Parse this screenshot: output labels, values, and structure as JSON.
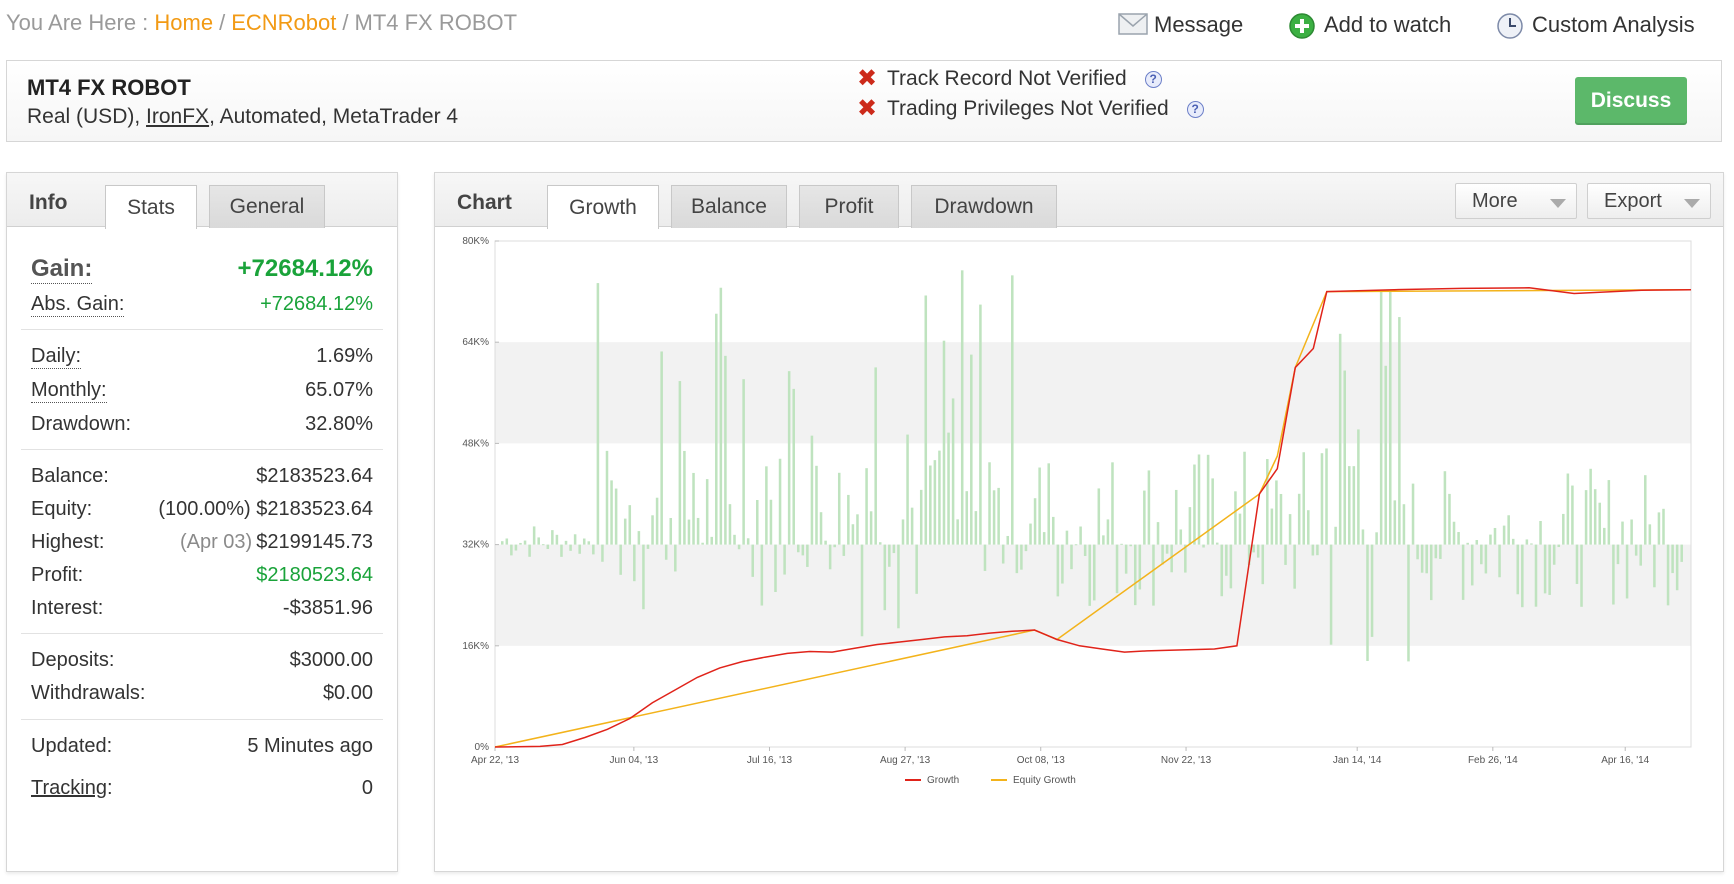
{
  "breadcrumb": {
    "prefix": "You Are Here :",
    "home": "Home",
    "parent": "ECNRobot",
    "current": "MT4 FX ROBOT"
  },
  "top_actions": {
    "message": "Message",
    "add_watch": "Add to watch",
    "custom_analysis": "Custom Analysis"
  },
  "header": {
    "title": "MT4 FX ROBOT",
    "sub_before": "Real (USD), ",
    "broker": "IronFX",
    "sub_after": ", Automated, MetaTrader 4",
    "track_record": "Track Record Not Verified",
    "trading_privileges": "Trading Privileges Not Verified",
    "discuss": "Discuss"
  },
  "info": {
    "tabs": {
      "info": "Info",
      "stats": "Stats",
      "general": "General"
    },
    "gain_label": "Gain:",
    "gain_value": "+72684.12%",
    "abs_gain_label": "Abs. Gain:",
    "abs_gain_value": "+72684.12%",
    "daily_label": "Daily:",
    "daily_value": "1.69%",
    "monthly_label": "Monthly:",
    "monthly_value": "65.07%",
    "drawdown_label": "Drawdown:",
    "drawdown_value": "32.80%",
    "balance_label": "Balance:",
    "balance_value": "$2183523.64",
    "equity_label": "Equity:",
    "equity_pct": "(100.00%)",
    "equity_value": "$2183523.64",
    "highest_label": "Highest:",
    "highest_date": "(Apr 03)",
    "highest_value": "$2199145.73",
    "profit_label": "Profit:",
    "profit_value": "$2180523.64",
    "interest_label": "Interest:",
    "interest_value": "-$3851.96",
    "deposits_label": "Deposits:",
    "deposits_value": "$3000.00",
    "withdrawals_label": "Withdrawals:",
    "withdrawals_value": "$0.00",
    "updated_label": "Updated:",
    "updated_value": "5 Minutes ago",
    "tracking_label": "Tracking",
    "tracking_colon": ":",
    "tracking_value": "0"
  },
  "chart": {
    "title": "Chart",
    "tabs": {
      "growth": "Growth",
      "balance": "Balance",
      "profit": "Profit",
      "drawdown": "Drawdown"
    },
    "more": "More",
    "export": "Export",
    "colors": {
      "growth": "#e0231a",
      "equity": "#f3b31b",
      "bars": "#bfe3bf",
      "band": "#f2f2f2"
    }
  },
  "chart_data": {
    "type": "line",
    "y_ticks": [
      "0%",
      "16K%",
      "32K%",
      "48K%",
      "64K%",
      "80K%"
    ],
    "x_ticks": [
      "Apr 22, '13",
      "Jun 04, '13",
      "Jul 16, '13",
      "Aug 27, '13",
      "Oct 08, '13",
      "Nov 22, '13",
      "Jan 14, '14",
      "Feb 26, '14",
      "Apr 16, '14"
    ],
    "ylim": [
      0,
      80000
    ],
    "legend": [
      "Growth",
      "Equity Growth"
    ],
    "growth": [
      [
        0,
        0
      ],
      [
        10,
        100
      ],
      [
        15,
        400
      ],
      [
        20,
        1500
      ],
      [
        25,
        2800
      ],
      [
        30,
        4500
      ],
      [
        35,
        7000
      ],
      [
        40,
        9000
      ],
      [
        45,
        11000
      ],
      [
        50,
        12500
      ],
      [
        55,
        13500
      ],
      [
        60,
        14200
      ],
      [
        65,
        14800
      ],
      [
        70,
        15100
      ],
      [
        75,
        15000
      ],
      [
        80,
        15600
      ],
      [
        85,
        16200
      ],
      [
        90,
        16600
      ],
      [
        95,
        17000
      ],
      [
        100,
        17400
      ],
      [
        105,
        17600
      ],
      [
        110,
        18000
      ],
      [
        115,
        18300
      ],
      [
        120,
        18500
      ],
      [
        125,
        17000
      ],
      [
        130,
        16000
      ],
      [
        135,
        15500
      ],
      [
        140,
        15000
      ],
      [
        145,
        15200
      ],
      [
        150,
        15300
      ],
      [
        155,
        15400
      ],
      [
        160,
        15500
      ],
      [
        165,
        16000
      ],
      [
        170,
        40000
      ],
      [
        174,
        44000
      ],
      [
        178,
        60000
      ],
      [
        182,
        63000
      ],
      [
        185,
        72000
      ],
      [
        200,
        72300
      ],
      [
        215,
        72500
      ],
      [
        230,
        72600
      ],
      [
        240,
        71700
      ],
      [
        255,
        72200
      ],
      [
        266,
        72300
      ]
    ],
    "equity": [
      [
        0,
        0
      ],
      [
        120,
        18500
      ],
      [
        125,
        17000
      ],
      [
        170,
        40000
      ],
      [
        174,
        46000
      ],
      [
        178,
        60000
      ],
      [
        185,
        72000
      ],
      [
        266,
        72300
      ]
    ],
    "bar_baseline": 32000
  }
}
